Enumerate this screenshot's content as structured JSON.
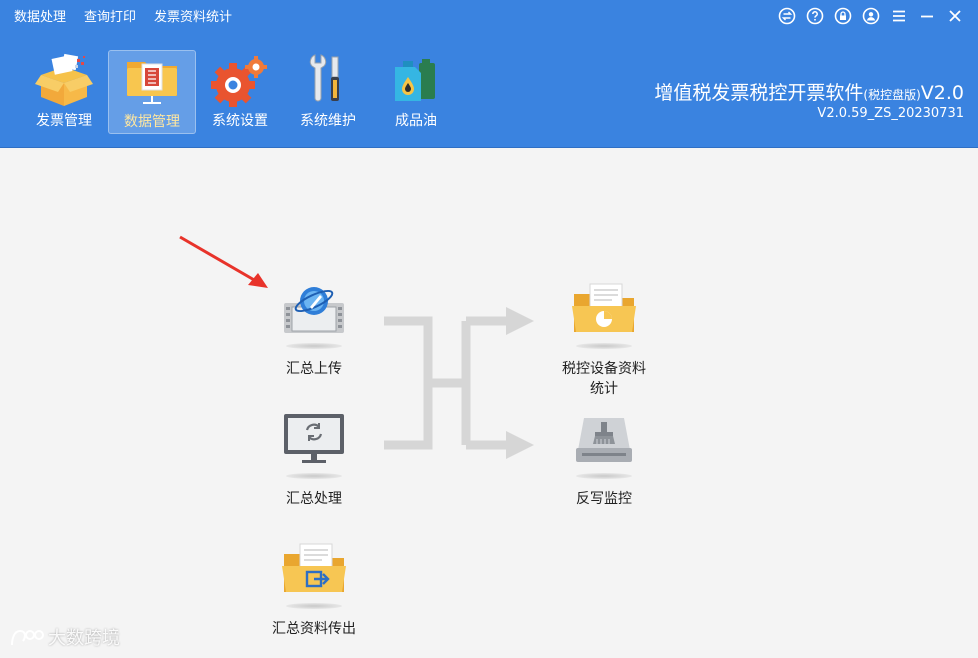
{
  "menubar": {
    "items": [
      "数据处理",
      "查询打印",
      "发票资料统计"
    ]
  },
  "window_controls": [
    "swap-icon",
    "help-icon",
    "lock-icon",
    "user-icon",
    "menu-icon",
    "minimize-icon",
    "close-icon"
  ],
  "toolbar": {
    "items": [
      {
        "label": "发票管理",
        "icon": "invoice-box-icon",
        "active": false
      },
      {
        "label": "数据管理",
        "icon": "data-folder-icon",
        "active": true
      },
      {
        "label": "系统设置",
        "icon": "gears-icon",
        "active": false
      },
      {
        "label": "系统维护",
        "icon": "tools-icon",
        "active": false
      },
      {
        "label": "成品油",
        "icon": "oil-can-icon",
        "active": false
      }
    ]
  },
  "app": {
    "title_main": "增值税发票税控开票软件",
    "title_edition": "(税控盘版)",
    "title_suffix": "V2.0",
    "version": "V2.0.59_ZS_20230731"
  },
  "functions": {
    "summary_upload": "汇总上传",
    "summary_process": "汇总处理",
    "summary_export": "汇总资料传出",
    "device_stats_line1": "税控设备资料",
    "device_stats_line2": "统计",
    "writeback_monitor": "反写监控"
  },
  "watermark": {
    "text": "大数跨境"
  },
  "colors": {
    "header_bg": "#3a83e0",
    "content_bg": "#f4f4f4",
    "arrow_red": "#e8332a",
    "flow_gray": "#d6d6d6"
  }
}
